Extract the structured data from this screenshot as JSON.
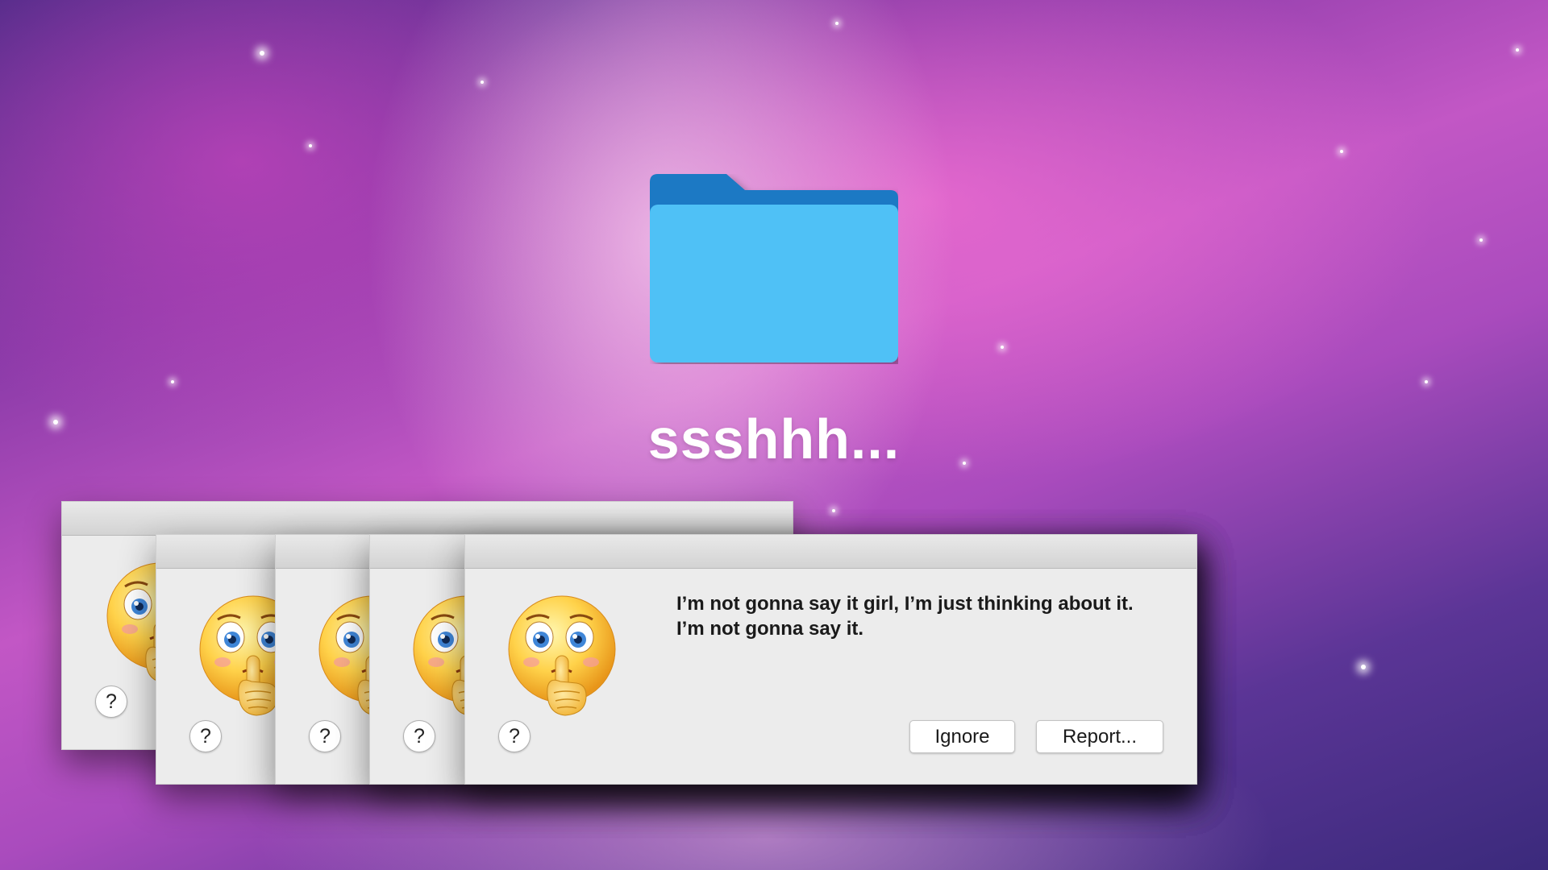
{
  "desktop": {
    "folder": {
      "icon": "folder-icon",
      "label": "ssshhh..."
    }
  },
  "dialog": {
    "message_line1": "I’m not gonna say it girl, I’m just thinking about it.",
    "message_line2": "I’m not gonna say it.",
    "emoji_icon": "shushing-face-icon",
    "help_label": "?",
    "ignore_label": "Ignore",
    "report_label": "Report...",
    "colors": {
      "background": "#ececec",
      "folder_front": "#4fc1f6",
      "folder_back": "#1e79c4"
    }
  }
}
